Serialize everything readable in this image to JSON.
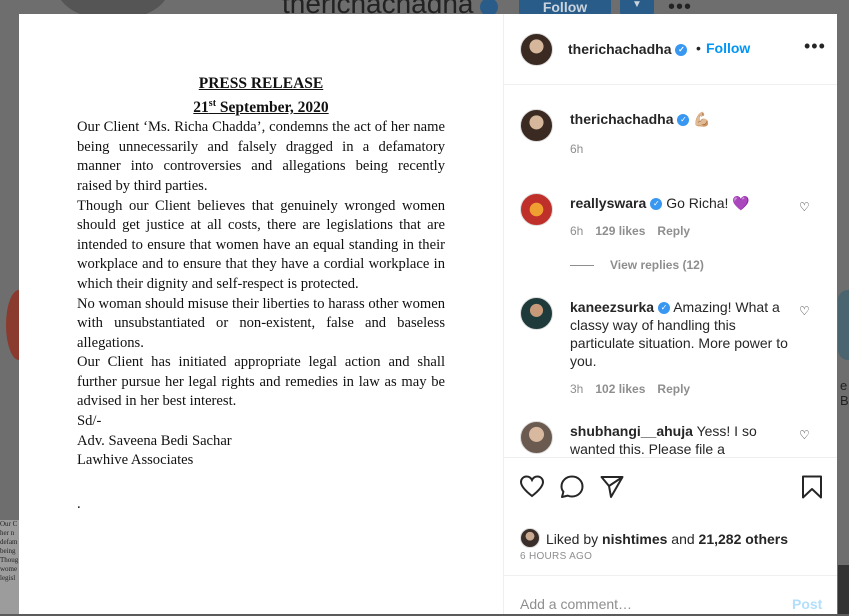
{
  "background": {
    "username": "therichachadha",
    "follow_label": "Follow",
    "doc_lines": [
      "Our C",
      "her n",
      "defam",
      "being",
      "Thoug",
      "wome",
      "legisl"
    ],
    "right_text": "e B"
  },
  "post": {
    "press_release": {
      "title": "PRESS RELEASE",
      "date_day": "21",
      "date_suffix": "st",
      "date_rest": " September, 2020",
      "paragraphs": [
        "Our Client ‘Ms. Richa Chadda’, condemns the act of her name being unnecessarily and falsely dragged in a defamatory manner into controversies and allegations being recently raised by third parties.",
        "Though our Client believes that genuinely wronged women should get justice at all costs, there are legislations that are intended to ensure that women have an equal standing in their workplace and to ensure that they have a cordial workplace in which their dignity and self-respect is protected.",
        "No woman should misuse their liberties to harass other women with unsubstantiated or non-existent, false and baseless allegations.",
        "Our Client has initiated appropriate legal action and shall further pursue her legal rights and remedies in law as may be advised in her best interest."
      ],
      "sign_off": "Sd/-",
      "signatory": "Adv. Saveena Bedi Sachar",
      "firm": "Lawhive Associates",
      "trailing_dot": "."
    }
  },
  "header": {
    "username": "therichachadha",
    "dot": "•",
    "follow_label": "Follow",
    "more": "•••"
  },
  "comments": [
    {
      "user": "therichachadha",
      "text": "💪🏼",
      "time": "6h"
    },
    {
      "user": "reallyswara",
      "text": "Go Richa! 💜",
      "time": "6h",
      "likes": "129 likes",
      "reply": "Reply",
      "view_replies": "View replies (12)"
    },
    {
      "user": "kaneezsurka",
      "text": "Amazing! What a classy way of handling this particulate situation. More power to you.",
      "time": "3h",
      "likes": "102 likes",
      "reply": "Reply"
    },
    {
      "user": "shubhangi__ahuja",
      "text": "Yess! I so wanted this. Please file a defamation. Yes, naval has the"
    }
  ],
  "likes": {
    "prefix": "Liked by ",
    "user": "nishtimes",
    "middle": " and ",
    "count": "21,282 others"
  },
  "time_ago": "6 HOURS AGO",
  "add_comment": {
    "placeholder": "Add a comment…",
    "post_label": "Post"
  }
}
